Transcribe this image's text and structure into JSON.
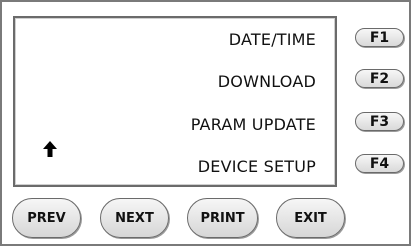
{
  "screen": {
    "menu_items": [
      {
        "label": "DATE/TIME"
      },
      {
        "label": "DOWNLOAD"
      },
      {
        "label": "PARAM UPDATE"
      },
      {
        "label": "DEVICE SETUP"
      }
    ],
    "indicator_icon": "arrow-up-icon"
  },
  "function_keys": [
    {
      "label": "F1"
    },
    {
      "label": "F2"
    },
    {
      "label": "F3"
    },
    {
      "label": "F4"
    }
  ],
  "soft_keys": {
    "prev": "PREV",
    "next": "NEXT",
    "print": "PRINT",
    "exit": "EXIT"
  }
}
